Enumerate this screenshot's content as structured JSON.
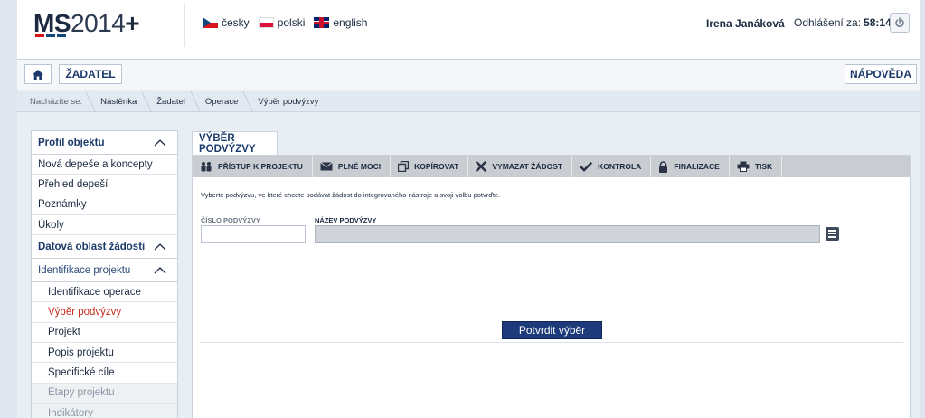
{
  "header": {
    "logo_bold": "MS",
    "logo_thin": "2014",
    "logo_plus": "+",
    "languages": [
      {
        "label": "česky",
        "icon": "flag-cz-icon"
      },
      {
        "label": "polski",
        "icon": "flag-pl-icon"
      },
      {
        "label": "english",
        "icon": "flag-gb-icon"
      }
    ],
    "user_name": "Irena Janáková",
    "logout_label": "Odhlášení za:",
    "logout_timer": "58:14"
  },
  "toolbar": {
    "applicant_label": "ŽADATEL",
    "help_label": "NÁPOVĚDA"
  },
  "breadcrumb": {
    "label": "Nacházíte se:",
    "items": [
      "Nástěnka",
      "Žadatel",
      "Operace",
      "Výběr podvýzvy"
    ]
  },
  "sidebar": {
    "sections": [
      {
        "title": "Profil objektu"
      },
      {
        "title": "Datová oblast žádosti"
      },
      {
        "title": "Identifikace projektu"
      }
    ],
    "profile_items": [
      "Nová depeše a koncepty",
      "Přehled depeší",
      "Poznámky",
      "Úkoly"
    ],
    "project_items": [
      "Identifikace operace",
      "Výběr podvýzvy",
      "Projekt",
      "Popis projektu",
      "Specifické cíle",
      "Etapy projektu",
      "Indikátory"
    ]
  },
  "main": {
    "tab_title": "VÝBĚR PODVÝZVY",
    "actions": [
      {
        "label": "PŘÍSTUP K PROJEKTU",
        "icon": "people-icon"
      },
      {
        "label": "PLNÉ MOCI",
        "icon": "envelope-icon"
      },
      {
        "label": "KOPÍROVAT",
        "icon": "copy-icon"
      },
      {
        "label": "VYMAZAT ŽÁDOST",
        "icon": "delete-icon"
      },
      {
        "label": "KONTROLA",
        "icon": "check-icon"
      },
      {
        "label": "FINALIZACE",
        "icon": "lock-icon"
      },
      {
        "label": "TISK",
        "icon": "print-icon"
      }
    ],
    "instruction": "Vyberte podvýzvu, ve které chcete podávat žádost do integrovaného nástroje a svoji volbu potvrďte.",
    "number_label": "ČÍSLO PODVÝZVY",
    "number_value": "",
    "name_label": "NÁZEV PODVÝZVY",
    "name_value": "",
    "confirm_label": "Potvrdit výběr"
  },
  "colors": {
    "primary": "#1d3a7a",
    "active_item": "#c42b1c",
    "action_bar": "#c9cdd2"
  }
}
